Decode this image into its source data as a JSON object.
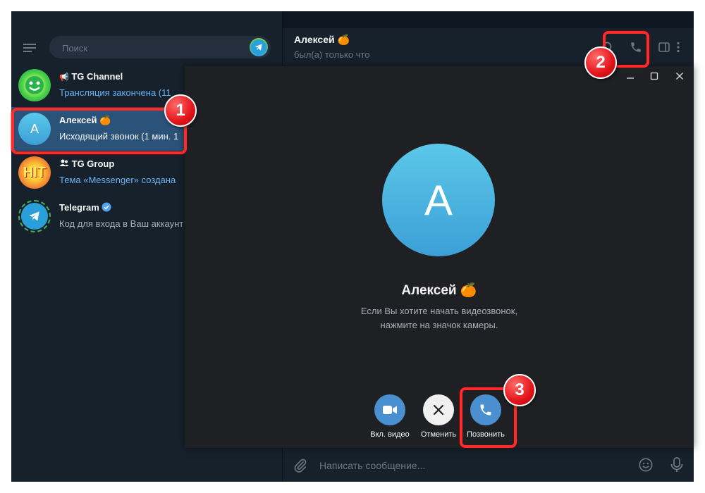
{
  "window": {
    "minimize": "—",
    "maximize": "☐",
    "close": "✕"
  },
  "search": {
    "placeholder": "Поиск"
  },
  "chats": [
    {
      "name": "TG Channel",
      "message": "Трансляция закончена (11",
      "type": "channel"
    },
    {
      "name": "Алексей",
      "message": "Исходящий звонок (1 мин. 1",
      "avatar_letter": "А",
      "active": true
    },
    {
      "name": "TG Group",
      "message": "Тема «Messenger» создана",
      "type": "group"
    },
    {
      "name": "Telegram",
      "message": "Код для входа в Ваш аккаунт",
      "verified": true
    }
  ],
  "chat_header": {
    "name": "Алексей",
    "status": "был(а) только что"
  },
  "composer": {
    "placeholder": "Написать сообщение..."
  },
  "call": {
    "avatar_letter": "А",
    "name": "Алексей",
    "hint_line1": "Если Вы хотите начать видеозвонок,",
    "hint_line2": "нажмите на значок камеры.",
    "buttons": [
      {
        "label": "Вкл. видео",
        "icon": "video-camera-icon",
        "color": "#4a8fd0"
      },
      {
        "label": "Отменить",
        "icon": "close-icon",
        "color": "#f0f0f0"
      },
      {
        "label": "Позвонить",
        "icon": "phone-icon",
        "color": "#4a8fd0"
      }
    ]
  },
  "annotations": {
    "step1": "1",
    "step2": "2",
    "step3": "3"
  },
  "colors": {
    "accent": "#2b5278",
    "highlight": "#ff2a2a",
    "link": "#6ab3f3"
  }
}
